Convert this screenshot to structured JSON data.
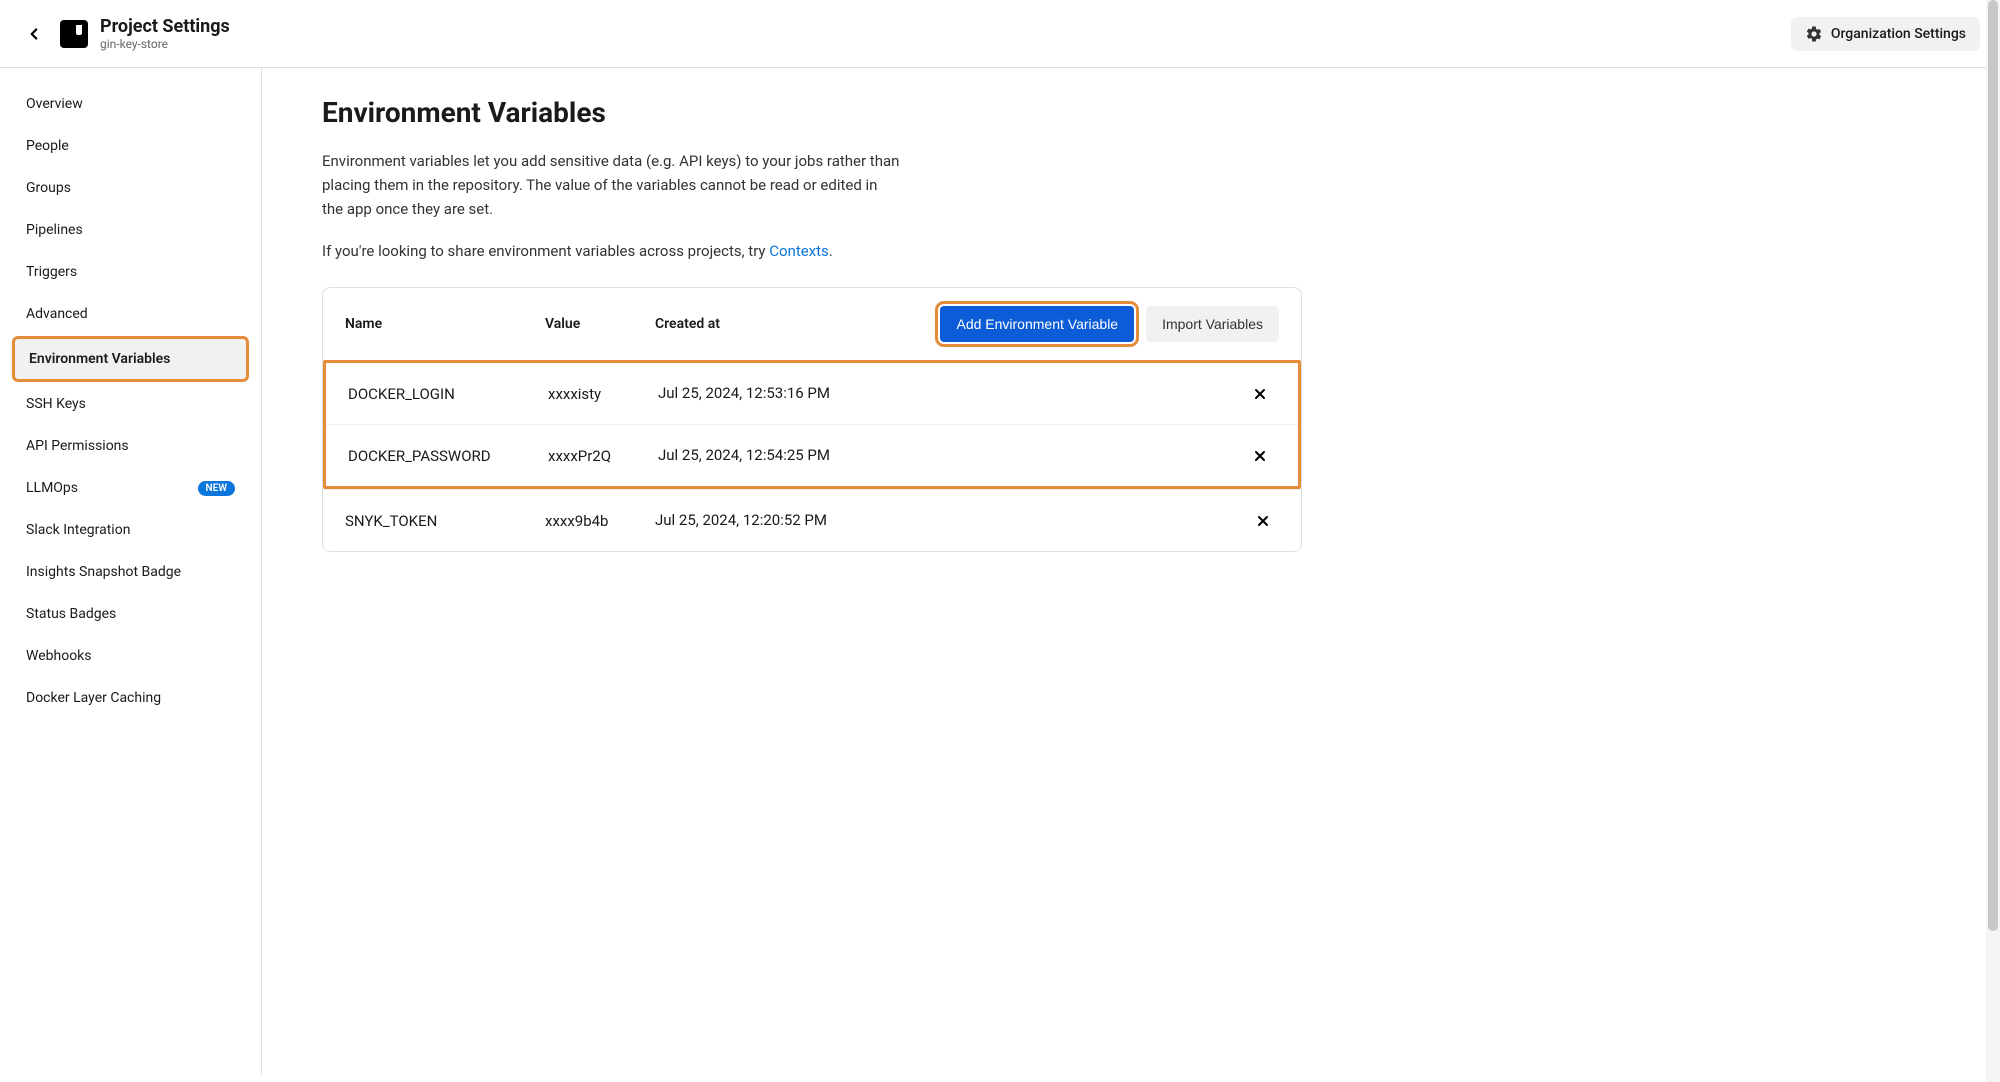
{
  "header": {
    "title": "Project Settings",
    "subtitle": "gin-key-store",
    "org_settings_label": "Organization Settings"
  },
  "sidebar": {
    "items": [
      {
        "label": "Overview",
        "active": false
      },
      {
        "label": "People",
        "active": false
      },
      {
        "label": "Groups",
        "active": false
      },
      {
        "label": "Pipelines",
        "active": false
      },
      {
        "label": "Triggers",
        "active": false
      },
      {
        "label": "Advanced",
        "active": false
      },
      {
        "label": "Environment Variables",
        "active": true
      },
      {
        "label": "SSH Keys",
        "active": false
      },
      {
        "label": "API Permissions",
        "active": false
      },
      {
        "label": "LLMOps",
        "active": false,
        "badge": "NEW"
      },
      {
        "label": "Slack Integration",
        "active": false
      },
      {
        "label": "Insights Snapshot Badge",
        "active": false
      },
      {
        "label": "Status Badges",
        "active": false
      },
      {
        "label": "Webhooks",
        "active": false
      },
      {
        "label": "Docker Layer Caching",
        "active": false
      }
    ]
  },
  "main": {
    "heading": "Environment Variables",
    "description1": "Environment variables let you add sensitive data (e.g. API keys) to your jobs rather than placing them in the repository. The value of the variables cannot be read or edited in the app once they are set.",
    "description2_prefix": "If you're looking to share environment variables across projects, try ",
    "description2_link": "Contexts",
    "description2_suffix": ".",
    "table": {
      "col_name": "Name",
      "col_value": "Value",
      "col_created": "Created at",
      "add_button": "Add Environment Variable",
      "import_button": "Import Variables",
      "rows": [
        {
          "name": "DOCKER_LOGIN",
          "value": "xxxxisty",
          "created": "Jul 25, 2024, 12:53:16 PM",
          "highlighted": true
        },
        {
          "name": "DOCKER_PASSWORD",
          "value": "xxxxPr2Q",
          "created": "Jul 25, 2024, 12:54:25 PM",
          "highlighted": true
        },
        {
          "name": "SNYK_TOKEN",
          "value": "xxxx9b4b",
          "created": "Jul 25, 2024, 12:20:52 PM",
          "highlighted": false
        }
      ]
    }
  }
}
